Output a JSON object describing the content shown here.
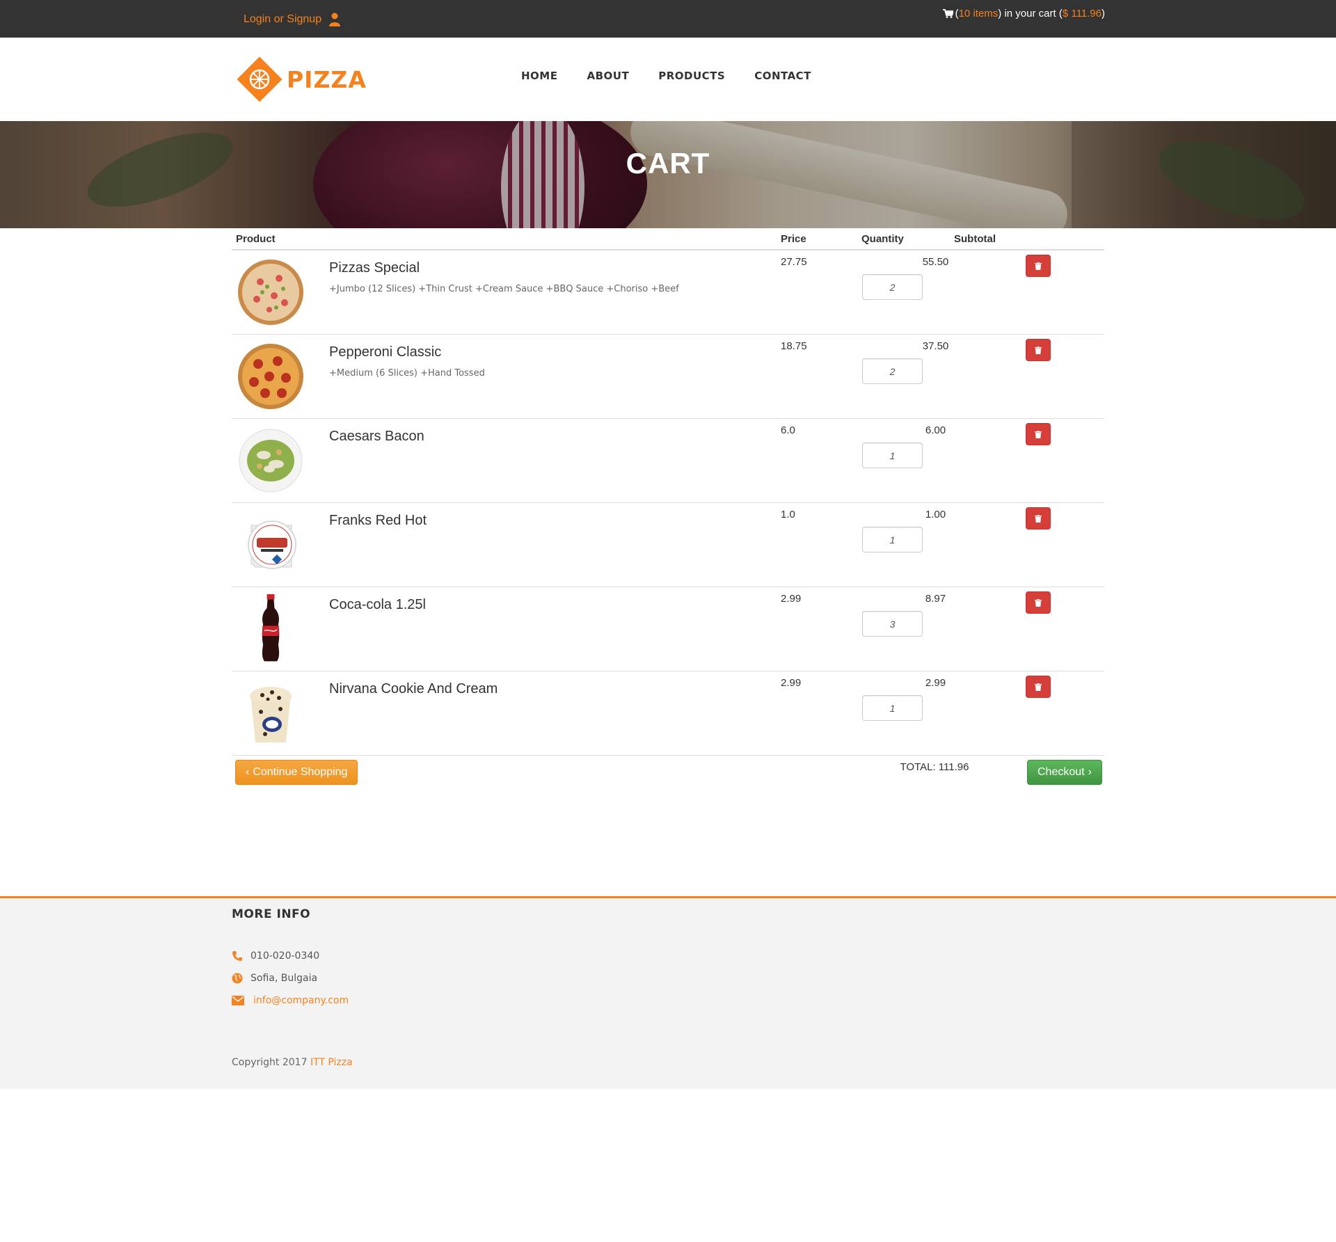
{
  "topbar": {
    "login_label": "Login or Signup",
    "cart_open": "(",
    "cart_items": "10 items",
    "cart_middle": ") in your cart (",
    "cart_total": "$ 111.96",
    "cart_close": ")"
  },
  "header": {
    "logo_text": "PIZZA",
    "nav": [
      "HOME",
      "ABOUT",
      "PRODUCTS",
      "CONTACT"
    ]
  },
  "banner": {
    "title": "CART"
  },
  "cart": {
    "columns": {
      "product": "Product",
      "price": "Price",
      "quantity": "Quantity",
      "subtotal": "Subtotal"
    },
    "items": [
      {
        "name": "Pizzas Special",
        "options": "+Jumbo (12 Slices) +Thin Crust +Cream Sauce +BBQ Sauce +Choriso +Beef",
        "price": "27.75",
        "quantity": "2",
        "subtotal": "55.50",
        "image": "pizza-special-image"
      },
      {
        "name": "Pepperoni Classic",
        "options": "+Medium (6 Slices) +Hand Tossed",
        "price": "18.75",
        "quantity": "2",
        "subtotal": "37.50",
        "image": "pepperoni-pizza-image"
      },
      {
        "name": "Caesars Bacon",
        "options": "",
        "price": "6.0",
        "quantity": "1",
        "subtotal": "6.00",
        "image": "caesar-salad-image"
      },
      {
        "name": "Franks Red Hot",
        "options": "",
        "price": "1.0",
        "quantity": "1",
        "subtotal": "1.00",
        "image": "red-hot-sauce-image"
      },
      {
        "name": "Coca-cola 1.25l",
        "options": "",
        "price": "2.99",
        "quantity": "3",
        "subtotal": "8.97",
        "image": "cola-bottle-image"
      },
      {
        "name": "Nirvana Cookie And Cream",
        "options": "",
        "price": "2.99",
        "quantity": "1",
        "subtotal": "2.99",
        "image": "ice-cream-cup-image"
      }
    ],
    "continue_label": "Continue Shopping",
    "total_label": "TOTAL: 111.96",
    "checkout_label": "Checkout"
  },
  "footer": {
    "heading": "MORE INFO",
    "phone": "010-020-0340",
    "address": "Sofia, Bulgaia",
    "email": "info@company.com",
    "copyright_prefix": "Copyright 2017 ",
    "copyright_brand": "ITT Pizza"
  },
  "colors": {
    "accent": "#f5821f",
    "topbar": "#333333",
    "delete": "#d43f3a",
    "checkout": "#5cb85c",
    "continue": "#f0a030",
    "footer_bg": "#f3f3f3"
  }
}
